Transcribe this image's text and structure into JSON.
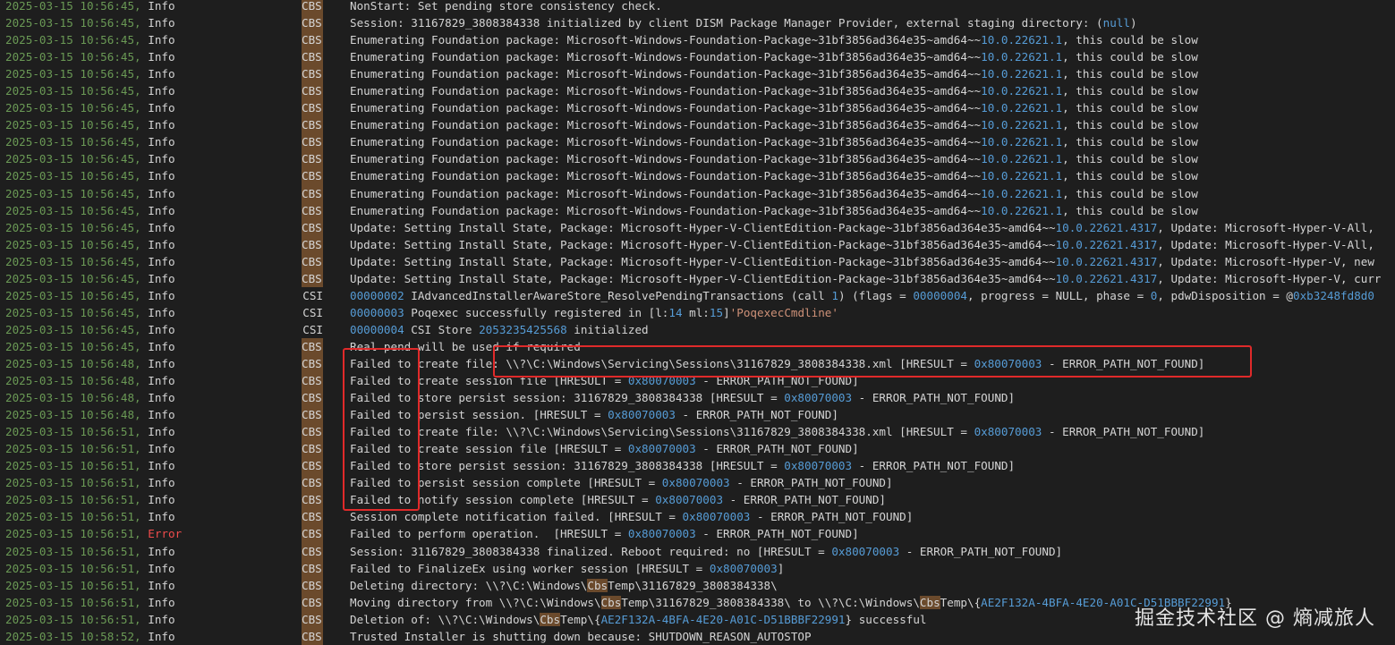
{
  "colors": {
    "timestamp": "#6a9955",
    "error": "#f14c4c",
    "number": "#569cd6",
    "string": "#ce9178",
    "highlight": "#6b4a2c",
    "annotation_box": "#e02a2a"
  },
  "log": [
    {
      "ts": "2025-03-15 10:56:45,",
      "lvl": "Info",
      "src": "CBS",
      "msg": [
        {
          "t": "NonStart: Set pending store consistency check."
        }
      ]
    },
    {
      "ts": "2025-03-15 10:56:45,",
      "lvl": "Info",
      "src": "CBS",
      "msg": [
        {
          "t": "Session: 31167829_3808384338 initialized by client DISM Package Manager Provider, external staging directory: ("
        },
        {
          "t": "null",
          "c": "num"
        },
        {
          "t": ")"
        }
      ]
    },
    {
      "ts": "2025-03-15 10:56:45,",
      "lvl": "Info",
      "src": "CBS",
      "msg": [
        {
          "t": "Enumerating Foundation package: Microsoft-Windows-Foundation-Package~31bf3856ad364e35~amd64~~"
        },
        {
          "t": "10.0.22621.1",
          "c": "num"
        },
        {
          "t": ", this could be slow"
        }
      ]
    },
    {
      "ts": "2025-03-15 10:56:45,",
      "lvl": "Info",
      "src": "CBS",
      "msg": [
        {
          "t": "Enumerating Foundation package: Microsoft-Windows-Foundation-Package~31bf3856ad364e35~amd64~~"
        },
        {
          "t": "10.0.22621.1",
          "c": "num"
        },
        {
          "t": ", this could be slow"
        }
      ]
    },
    {
      "ts": "2025-03-15 10:56:45,",
      "lvl": "Info",
      "src": "CBS",
      "msg": [
        {
          "t": "Enumerating Foundation package: Microsoft-Windows-Foundation-Package~31bf3856ad364e35~amd64~~"
        },
        {
          "t": "10.0.22621.1",
          "c": "num"
        },
        {
          "t": ", this could be slow"
        }
      ]
    },
    {
      "ts": "2025-03-15 10:56:45,",
      "lvl": "Info",
      "src": "CBS",
      "msg": [
        {
          "t": "Enumerating Foundation package: Microsoft-Windows-Foundation-Package~31bf3856ad364e35~amd64~~"
        },
        {
          "t": "10.0.22621.1",
          "c": "num"
        },
        {
          "t": ", this could be slow"
        }
      ]
    },
    {
      "ts": "2025-03-15 10:56:45,",
      "lvl": "Info",
      "src": "CBS",
      "msg": [
        {
          "t": "Enumerating Foundation package: Microsoft-Windows-Foundation-Package~31bf3856ad364e35~amd64~~"
        },
        {
          "t": "10.0.22621.1",
          "c": "num"
        },
        {
          "t": ", this could be slow"
        }
      ]
    },
    {
      "ts": "2025-03-15 10:56:45,",
      "lvl": "Info",
      "src": "CBS",
      "msg": [
        {
          "t": "Enumerating Foundation package: Microsoft-Windows-Foundation-Package~31bf3856ad364e35~amd64~~"
        },
        {
          "t": "10.0.22621.1",
          "c": "num"
        },
        {
          "t": ", this could be slow"
        }
      ]
    },
    {
      "ts": "2025-03-15 10:56:45,",
      "lvl": "Info",
      "src": "CBS",
      "msg": [
        {
          "t": "Enumerating Foundation package: Microsoft-Windows-Foundation-Package~31bf3856ad364e35~amd64~~"
        },
        {
          "t": "10.0.22621.1",
          "c": "num"
        },
        {
          "t": ", this could be slow"
        }
      ]
    },
    {
      "ts": "2025-03-15 10:56:45,",
      "lvl": "Info",
      "src": "CBS",
      "msg": [
        {
          "t": "Enumerating Foundation package: Microsoft-Windows-Foundation-Package~31bf3856ad364e35~amd64~~"
        },
        {
          "t": "10.0.22621.1",
          "c": "num"
        },
        {
          "t": ", this could be slow"
        }
      ]
    },
    {
      "ts": "2025-03-15 10:56:45,",
      "lvl": "Info",
      "src": "CBS",
      "msg": [
        {
          "t": "Enumerating Foundation package: Microsoft-Windows-Foundation-Package~31bf3856ad364e35~amd64~~"
        },
        {
          "t": "10.0.22621.1",
          "c": "num"
        },
        {
          "t": ", this could be slow"
        }
      ]
    },
    {
      "ts": "2025-03-15 10:56:45,",
      "lvl": "Info",
      "src": "CBS",
      "msg": [
        {
          "t": "Enumerating Foundation package: Microsoft-Windows-Foundation-Package~31bf3856ad364e35~amd64~~"
        },
        {
          "t": "10.0.22621.1",
          "c": "num"
        },
        {
          "t": ", this could be slow"
        }
      ]
    },
    {
      "ts": "2025-03-15 10:56:45,",
      "lvl": "Info",
      "src": "CBS",
      "msg": [
        {
          "t": "Enumerating Foundation package: Microsoft-Windows-Foundation-Package~31bf3856ad364e35~amd64~~"
        },
        {
          "t": "10.0.22621.1",
          "c": "num"
        },
        {
          "t": ", this could be slow"
        }
      ]
    },
    {
      "ts": "2025-03-15 10:56:45,",
      "lvl": "Info",
      "src": "CBS",
      "msg": [
        {
          "t": "Update: Setting Install State, Package: Microsoft-Hyper-V-ClientEdition-Package~31bf3856ad364e35~amd64~~"
        },
        {
          "t": "10.0.22621.4317",
          "c": "num"
        },
        {
          "t": ", Update: Microsoft-Hyper-V-All,"
        }
      ]
    },
    {
      "ts": "2025-03-15 10:56:45,",
      "lvl": "Info",
      "src": "CBS",
      "msg": [
        {
          "t": "Update: Setting Install State, Package: Microsoft-Hyper-V-ClientEdition-Package~31bf3856ad364e35~amd64~~"
        },
        {
          "t": "10.0.22621.4317",
          "c": "num"
        },
        {
          "t": ", Update: Microsoft-Hyper-V-All,"
        }
      ]
    },
    {
      "ts": "2025-03-15 10:56:45,",
      "lvl": "Info",
      "src": "CBS",
      "msg": [
        {
          "t": "Update: Setting Install State, Package: Microsoft-Hyper-V-ClientEdition-Package~31bf3856ad364e35~amd64~~"
        },
        {
          "t": "10.0.22621.4317",
          "c": "num"
        },
        {
          "t": ", Update: Microsoft-Hyper-V, new"
        }
      ]
    },
    {
      "ts": "2025-03-15 10:56:45,",
      "lvl": "Info",
      "src": "CBS",
      "msg": [
        {
          "t": "Update: Setting Install State, Package: Microsoft-Hyper-V-ClientEdition-Package~31bf3856ad364e35~amd64~~"
        },
        {
          "t": "10.0.22621.4317",
          "c": "num"
        },
        {
          "t": ", Update: Microsoft-Hyper-V, curr"
        }
      ]
    },
    {
      "ts": "2025-03-15 10:56:45,",
      "lvl": "Info",
      "src": "CSI",
      "msg": [
        {
          "t": "00000002",
          "c": "num"
        },
        {
          "t": " IAdvancedInstallerAwareStore_ResolvePendingTransactions (call "
        },
        {
          "t": "1",
          "c": "num"
        },
        {
          "t": ") (flags = "
        },
        {
          "t": "00000004",
          "c": "num"
        },
        {
          "t": ", progress = NULL, phase = "
        },
        {
          "t": "0",
          "c": "num"
        },
        {
          "t": ", pdwDisposition = @"
        },
        {
          "t": "0xb3248fd8d0",
          "c": "num"
        }
      ]
    },
    {
      "ts": "2025-03-15 10:56:45,",
      "lvl": "Info",
      "src": "CSI",
      "msg": [
        {
          "t": "00000003",
          "c": "num"
        },
        {
          "t": " Poqexec successfully registered in [l:"
        },
        {
          "t": "14",
          "c": "num"
        },
        {
          "t": " ml:"
        },
        {
          "t": "15",
          "c": "num"
        },
        {
          "t": "]"
        },
        {
          "t": "'PoqexecCmdline'",
          "c": "str"
        }
      ]
    },
    {
      "ts": "2025-03-15 10:56:45,",
      "lvl": "Info",
      "src": "CSI",
      "msg": [
        {
          "t": "00000004",
          "c": "num"
        },
        {
          "t": " CSI Store "
        },
        {
          "t": "2053235425568",
          "c": "num"
        },
        {
          "t": " initialized"
        }
      ]
    },
    {
      "ts": "2025-03-15 10:56:45,",
      "lvl": "Info",
      "src": "CBS",
      "msg": [
        {
          "t": "Real pend will be used if required"
        }
      ]
    },
    {
      "ts": "2025-03-15 10:56:48,",
      "lvl": "Info",
      "src": "CBS",
      "msg": [
        {
          "t": "Failed to create file: \\\\?\\C:\\Windows\\Servicing\\Sessions\\31167829_3808384338.xml [HRESULT = "
        },
        {
          "t": "0x80070003",
          "c": "num"
        },
        {
          "t": " - ERROR_PATH_NOT_FOUND]"
        }
      ]
    },
    {
      "ts": "2025-03-15 10:56:48,",
      "lvl": "Info",
      "src": "CBS",
      "msg": [
        {
          "t": "Failed to create session file [HRESULT = "
        },
        {
          "t": "0x80070003",
          "c": "num"
        },
        {
          "t": " - ERROR_PATH_NOT_FOUND]"
        }
      ]
    },
    {
      "ts": "2025-03-15 10:56:48,",
      "lvl": "Info",
      "src": "CBS",
      "msg": [
        {
          "t": "Failed to store persist session: 31167829_3808384338 [HRESULT = "
        },
        {
          "t": "0x80070003",
          "c": "num"
        },
        {
          "t": " - ERROR_PATH_NOT_FOUND]"
        }
      ]
    },
    {
      "ts": "2025-03-15 10:56:48,",
      "lvl": "Info",
      "src": "CBS",
      "msg": [
        {
          "t": "Failed to persist session. [HRESULT = "
        },
        {
          "t": "0x80070003",
          "c": "num"
        },
        {
          "t": " - ERROR_PATH_NOT_FOUND]"
        }
      ]
    },
    {
      "ts": "2025-03-15 10:56:51,",
      "lvl": "Info",
      "src": "CBS",
      "msg": [
        {
          "t": "Failed to create file: \\\\?\\C:\\Windows\\Servicing\\Sessions\\31167829_3808384338.xml [HRESULT = "
        },
        {
          "t": "0x80070003",
          "c": "num"
        },
        {
          "t": " - ERROR_PATH_NOT_FOUND]"
        }
      ]
    },
    {
      "ts": "2025-03-15 10:56:51,",
      "lvl": "Info",
      "src": "CBS",
      "msg": [
        {
          "t": "Failed to create session file [HRESULT = "
        },
        {
          "t": "0x80070003",
          "c": "num"
        },
        {
          "t": " - ERROR_PATH_NOT_FOUND]"
        }
      ]
    },
    {
      "ts": "2025-03-15 10:56:51,",
      "lvl": "Info",
      "src": "CBS",
      "msg": [
        {
          "t": "Failed to store persist session: 31167829_3808384338 [HRESULT = "
        },
        {
          "t": "0x80070003",
          "c": "num"
        },
        {
          "t": " - ERROR_PATH_NOT_FOUND]"
        }
      ]
    },
    {
      "ts": "2025-03-15 10:56:51,",
      "lvl": "Info",
      "src": "CBS",
      "msg": [
        {
          "t": "Failed to persist session complete [HRESULT = "
        },
        {
          "t": "0x80070003",
          "c": "num"
        },
        {
          "t": " - ERROR_PATH_NOT_FOUND]"
        }
      ]
    },
    {
      "ts": "2025-03-15 10:56:51,",
      "lvl": "Info",
      "src": "CBS",
      "msg": [
        {
          "t": "Failed to notify session complete [HRESULT = "
        },
        {
          "t": "0x80070003",
          "c": "num"
        },
        {
          "t": " - ERROR_PATH_NOT_FOUND]"
        }
      ]
    },
    {
      "ts": "2025-03-15 10:56:51,",
      "lvl": "Info",
      "src": "CBS",
      "msg": [
        {
          "t": "Session complete notification failed. [HRESULT = "
        },
        {
          "t": "0x80070003",
          "c": "num"
        },
        {
          "t": " - ERROR_PATH_NOT_FOUND]"
        }
      ]
    },
    {
      "ts": "2025-03-15 10:56:51,",
      "lvl": "Error",
      "src": "CBS",
      "msg": [
        {
          "t": "Failed to perform operation.  [HRESULT = "
        },
        {
          "t": "0x80070003",
          "c": "num"
        },
        {
          "t": " - ERROR_PATH_NOT_FOUND]"
        }
      ]
    },
    {
      "ts": "2025-03-15 10:56:51,",
      "lvl": "Info",
      "src": "CBS",
      "msg": [
        {
          "t": "Session: 31167829_3808384338 finalized. Reboot required: no [HRESULT = "
        },
        {
          "t": "0x80070003",
          "c": "num"
        },
        {
          "t": " - ERROR_PATH_NOT_FOUND]"
        }
      ]
    },
    {
      "ts": "2025-03-15 10:56:51,",
      "lvl": "Info",
      "src": "CBS",
      "msg": [
        {
          "t": "Failed to FinalizeEx using worker session [HRESULT = "
        },
        {
          "t": "0x80070003",
          "c": "num"
        },
        {
          "t": "]"
        }
      ]
    },
    {
      "ts": "2025-03-15 10:56:51,",
      "lvl": "Info",
      "src": "CBS",
      "msg": [
        {
          "t": "Deleting directory: \\\\?\\C:\\Windows\\"
        },
        {
          "t": "Cbs",
          "c": "hl"
        },
        {
          "t": "Temp\\31167829_3808384338\\"
        }
      ]
    },
    {
      "ts": "2025-03-15 10:56:51,",
      "lvl": "Info",
      "src": "CBS",
      "msg": [
        {
          "t": "Moving directory from \\\\?\\C:\\Windows\\"
        },
        {
          "t": "Cbs",
          "c": "hl"
        },
        {
          "t": "Temp\\31167829_3808384338\\ to \\\\?\\C:\\Windows\\"
        },
        {
          "t": "Cbs",
          "c": "hl"
        },
        {
          "t": "Temp\\{"
        },
        {
          "t": "AE2F132A-4BFA-4E20-A01C-D51BBBF22991",
          "c": "num"
        },
        {
          "t": "}"
        }
      ]
    },
    {
      "ts": "2025-03-15 10:56:51,",
      "lvl": "Info",
      "src": "CBS",
      "msg": [
        {
          "t": "Deletion of: \\\\?\\C:\\Windows\\"
        },
        {
          "t": "Cbs",
          "c": "hl"
        },
        {
          "t": "Temp\\{"
        },
        {
          "t": "AE2F132A-4BFA-4E20-A01C-D51BBBF22991",
          "c": "num"
        },
        {
          "t": "} successful"
        }
      ]
    },
    {
      "ts": "2025-03-15 10:58:52,",
      "lvl": "Info",
      "src": "CBS",
      "msg": [
        {
          "t": "Trusted Installer is shutting down because: SHUTDOWN_REASON_AUTOSTOP"
        }
      ]
    }
  ],
  "watermark": "掘金技术社区 @ 熵减旅人"
}
